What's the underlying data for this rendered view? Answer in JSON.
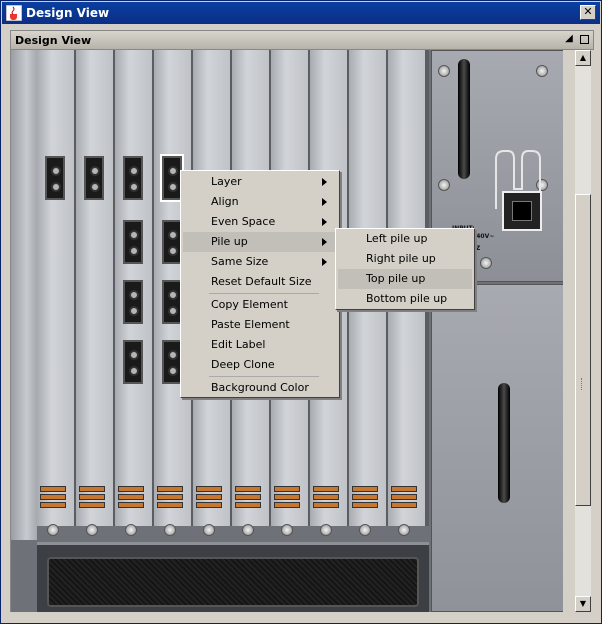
{
  "window": {
    "title": "Design View"
  },
  "panel": {
    "title": "Design View"
  },
  "context_menu": {
    "items": [
      {
        "label": "Layer",
        "submenu": true
      },
      {
        "label": "Align",
        "submenu": true
      },
      {
        "label": "Even Space",
        "submenu": true
      },
      {
        "label": "Pile up",
        "submenu": true,
        "highlighted": true
      },
      {
        "label": "Same Size",
        "submenu": true
      },
      {
        "label": "Reset Default Size",
        "submenu": false
      },
      {
        "label": "Copy Element",
        "submenu": false
      },
      {
        "label": "Paste Element",
        "submenu": false
      },
      {
        "label": "Edit Label",
        "submenu": false
      },
      {
        "label": "Deep Clone",
        "submenu": false
      },
      {
        "label": "Background Color",
        "submenu": false
      }
    ]
  },
  "submenu": {
    "items": [
      {
        "label": "Left pile up"
      },
      {
        "label": "Right pile up"
      },
      {
        "label": "Top pile up",
        "highlighted": true
      },
      {
        "label": "Bottom pile up"
      }
    ]
  },
  "psu": {
    "label_line1": "INPUT:",
    "label_line2": "~100-240V~",
    "label_line3": "50/60HZ"
  },
  "icons": {
    "app": "java-cup-icon",
    "close": "close-icon",
    "pin": "pin-icon",
    "maximize": "maximize-icon"
  }
}
